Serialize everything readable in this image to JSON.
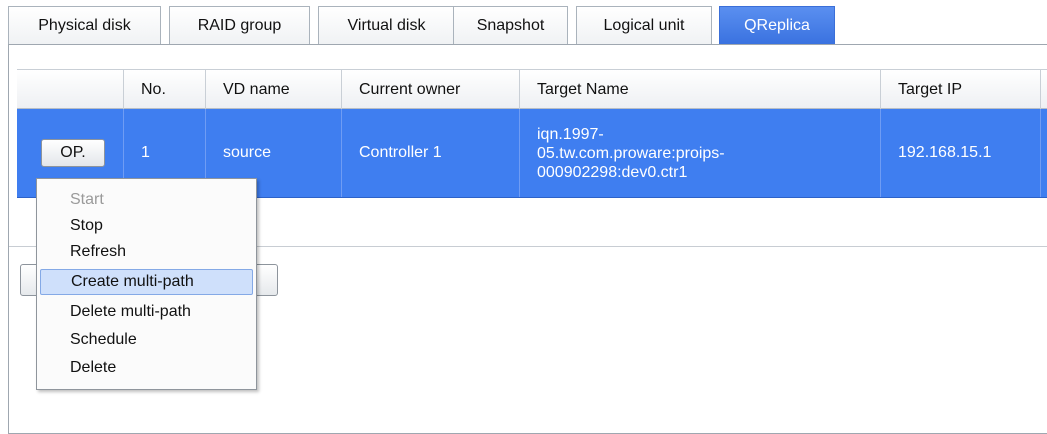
{
  "tabs": [
    {
      "label": "Physical disk",
      "active": false
    },
    {
      "label": "RAID group",
      "active": false
    },
    {
      "label": "Virtual disk",
      "active": false
    },
    {
      "label": "Snapshot",
      "active": false
    },
    {
      "label": "Logical unit",
      "active": false
    },
    {
      "label": "QReplica",
      "active": true
    }
  ],
  "table": {
    "headers": [
      "",
      "No.",
      "VD name",
      "Current owner",
      "Target Name",
      "Target IP"
    ],
    "rows": [
      {
        "op_label": "OP.",
        "no": "1",
        "vd_name": "source",
        "current_owner": "Controller 1",
        "target_name_lines": [
          "iqn.1997-",
          "05.tw.com.proware:proips-",
          "000902298:dev0.ctr1"
        ],
        "target_ip": "192.168.15.1",
        "selected": true
      }
    ]
  },
  "context_menu": {
    "items": [
      {
        "label": "Start",
        "enabled": false
      },
      {
        "label": "Stop",
        "enabled": true
      },
      {
        "label": "Refresh",
        "enabled": true
      },
      {
        "label": "Create multi-path",
        "enabled": true,
        "highlighted": true
      },
      {
        "label": "Delete multi-path",
        "enabled": true
      },
      {
        "label": "Schedule",
        "enabled": true
      },
      {
        "label": "Delete",
        "enabled": true
      }
    ]
  },
  "colors": {
    "selection": "#3f7ef0",
    "active_tab": "#3a72e0",
    "menu_highlight": "#cfe0fb"
  }
}
